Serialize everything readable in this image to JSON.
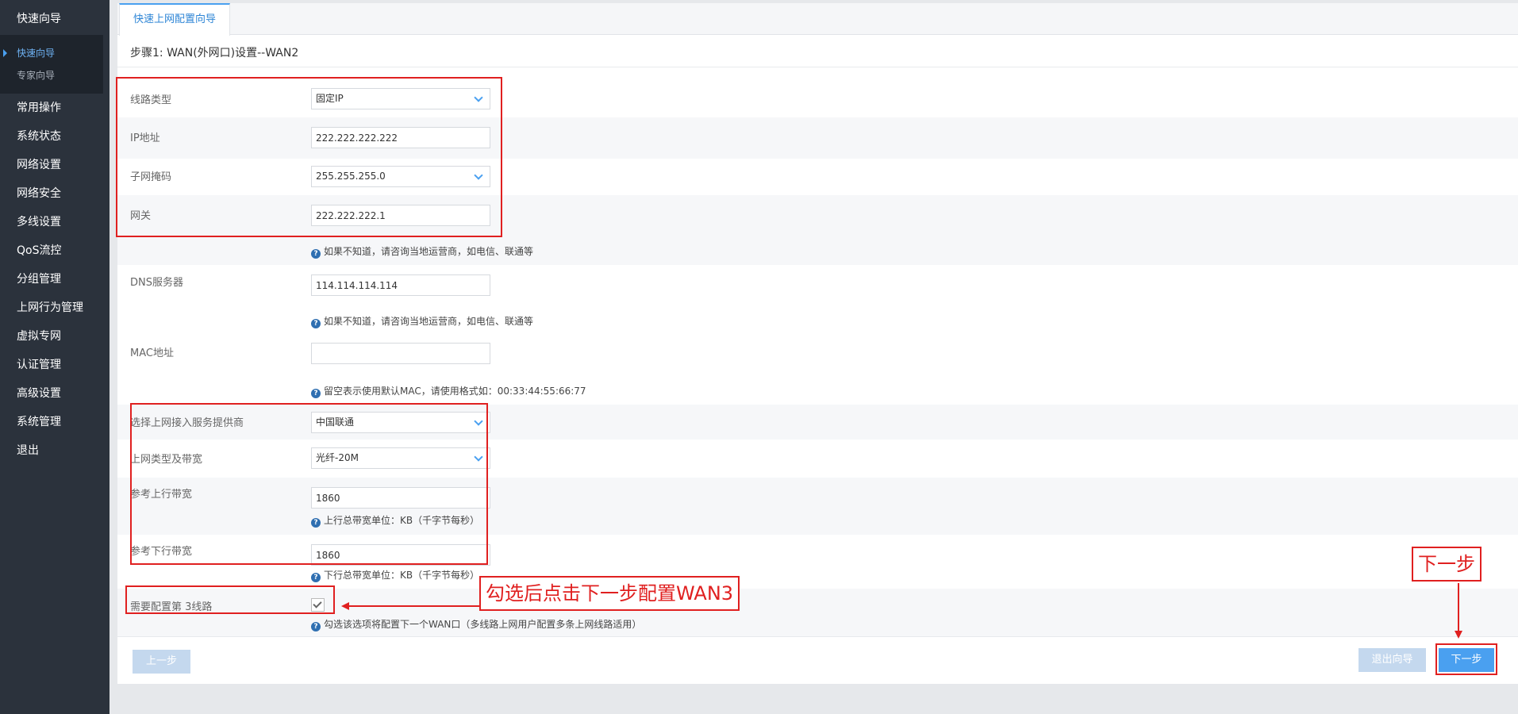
{
  "sidebar": {
    "top_item": "快速向导",
    "sub_items": [
      "快速向导",
      "专家向导"
    ],
    "items": [
      "常用操作",
      "系统状态",
      "网络设置",
      "网络安全",
      "多线设置",
      "QoS流控",
      "分组管理",
      "上网行为管理",
      "虚拟专网",
      "认证管理",
      "高级设置",
      "系统管理",
      "退出"
    ]
  },
  "tab": {
    "label": "快速上网配置向导"
  },
  "step_title": "步骤1: WAN(外网口)设置--WAN2",
  "form": {
    "line_type": {
      "label": "线路类型",
      "value": "固定IP"
    },
    "ip": {
      "label": "IP地址",
      "value": "222.222.222.222"
    },
    "subnet": {
      "label": "子网掩码",
      "value": "255.255.255.0"
    },
    "gateway": {
      "label": "网关",
      "value": "222.222.222.1"
    },
    "gateway_hint": "如果不知道，请咨询当地运营商，如电信、联通等",
    "dns": {
      "label": "DNS服务器",
      "value": "114.114.114.114"
    },
    "dns_hint": "如果不知道，请咨询当地运营商，如电信、联通等",
    "mac": {
      "label": "MAC地址",
      "value": ""
    },
    "mac_hint": "留空表示使用默认MAC，请使用格式如：00:33:44:55:66:77",
    "isp": {
      "label": "选择上网接入服务提供商",
      "value": "中国联通"
    },
    "bandwidth_type": {
      "label": "上网类型及带宽",
      "value": "光纤-20M"
    },
    "up_bw": {
      "label": "参考上行带宽",
      "value": "1860",
      "hint": "上行总带宽单位：KB（千字节每秒）"
    },
    "down_bw": {
      "label": "参考下行带宽",
      "value": "1860",
      "hint": "下行总带宽单位：KB（千字节每秒）"
    },
    "third_line": {
      "label": "需要配置第 3线路",
      "checked": true,
      "hint": "勾选该选项将配置下一个WAN口（多线路上网用户配置多条上网线路适用）"
    }
  },
  "buttons": {
    "prev": "上一步",
    "exit": "退出向导",
    "next": "下一步"
  },
  "annotations": {
    "checkbox_note": "勾选后点击下一步配置WAN3",
    "next_note": "下一步",
    "color": "#e02020"
  },
  "colors": {
    "accent": "#4aa0f0",
    "sidebar_bg": "#2b323c"
  }
}
